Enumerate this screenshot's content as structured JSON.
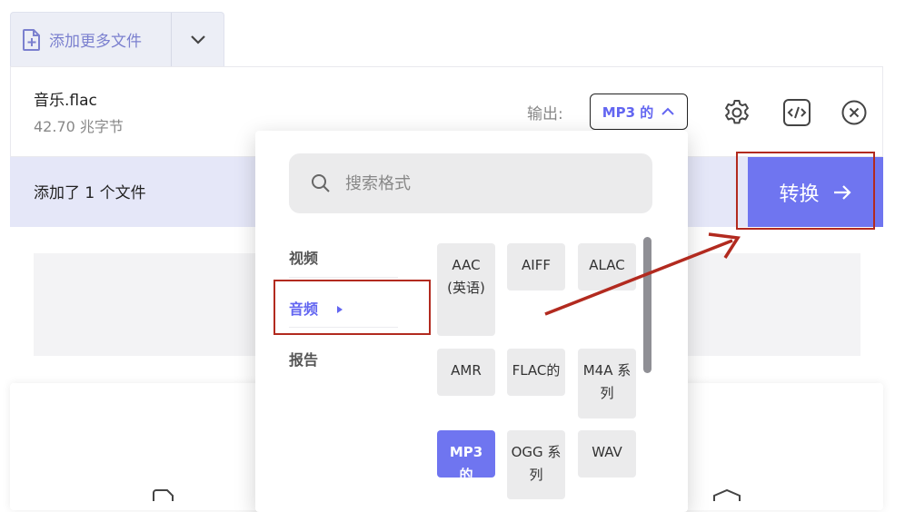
{
  "toolbar": {
    "add_more_label": "添加更多文件"
  },
  "file": {
    "name": "音乐.flac",
    "size": "42.70 兆字节"
  },
  "output": {
    "label": "输出:",
    "selected_format": "MP3 的"
  },
  "status": {
    "text": "添加了 1 个文件"
  },
  "convert": {
    "label": "转换"
  },
  "format_menu": {
    "search_placeholder": "搜索格式",
    "categories": [
      "视频",
      "音频",
      "报告"
    ],
    "active_category": "音频",
    "options": [
      "AAC (英语)",
      "AIFF",
      "ALAC",
      "AMR",
      "FLAC的",
      "M4A 系列",
      "MP3 的",
      "OGG 系列",
      "WAV"
    ],
    "selected_option": "MP3 的"
  },
  "colors": {
    "accent": "#6f75f0",
    "highlight": "#b22a1f",
    "status_bg": "#e5e7f8"
  }
}
